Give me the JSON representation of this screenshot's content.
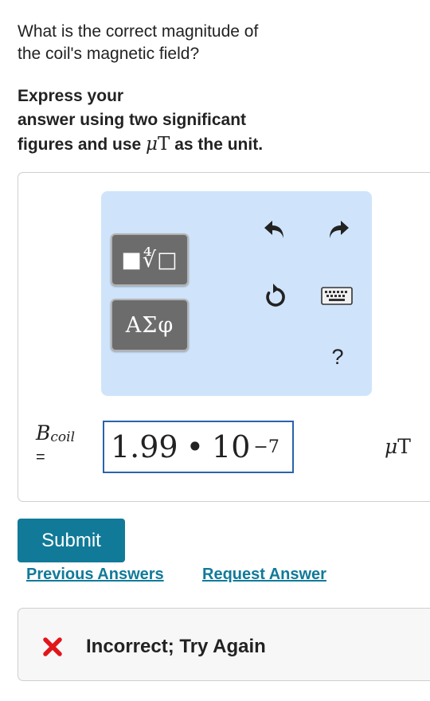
{
  "question": {
    "line1": "What is the correct magnitude of",
    "line2": "the coil's magnetic field?"
  },
  "instruction": {
    "line1": "Express your",
    "line2": "answer using two significant",
    "line3_prefix": "figures and use",
    "unit_mu": "μ",
    "unit_letter": "T",
    "line3_suffix": "as the unit."
  },
  "toolbar": {
    "templates_label": "■∜□",
    "symbols_label": "ΑΣφ",
    "help_label": "?"
  },
  "answer": {
    "variable": "B",
    "variable_subscript": "coil",
    "equals": "=",
    "mantissa": "1.99",
    "operator": "•",
    "base": "10",
    "exponent": "−7",
    "unit_mu": "μ",
    "unit_letter": "T"
  },
  "actions": {
    "submit_label": "Submit",
    "previous_answers_label": "Previous Answers",
    "request_answer_label": "Request Answer"
  },
  "feedback": {
    "status_text": "Incorrect; Try Again",
    "status_color": "#e1161b"
  },
  "colors": {
    "accent": "#117a99",
    "toolbar_bg": "#cfe4fb",
    "input_border": "#2a63ad"
  }
}
